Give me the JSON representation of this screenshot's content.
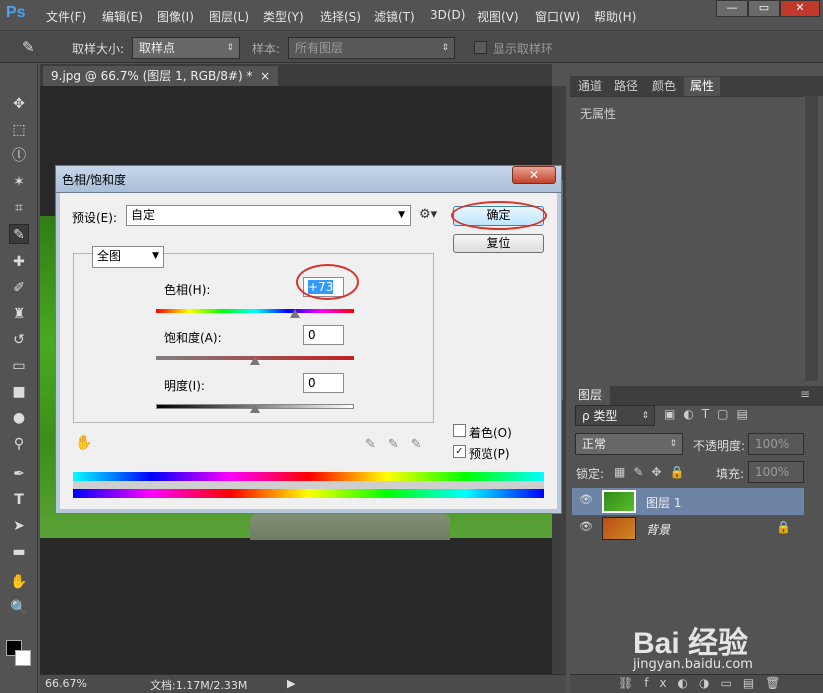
{
  "app": {
    "logo": "Ps"
  },
  "menu": [
    "文件(F)",
    "编辑(E)",
    "图像(I)",
    "图层(L)",
    "类型(Y)",
    "选择(S)",
    "滤镜(T)",
    "3D(D)",
    "视图(V)",
    "窗口(W)",
    "帮助(H)"
  ],
  "window_controls": {
    "minimize": "—",
    "restore": "▭",
    "close": "✕"
  },
  "options": {
    "sample_size_label": "取样大小:",
    "sample_size_value": "取样点",
    "sample_label": "样本:",
    "sample_value": "所有图层",
    "show_ring_label": "显示取样环"
  },
  "document": {
    "tab_title": "9.jpg @ 66.7% (图层 1, RGB/8#) *",
    "tab_close": "×",
    "zoom": "66.67%",
    "doc_info": "文档:1.17M/2.33M"
  },
  "panels": {
    "tabs": [
      "通道",
      "路径",
      "颜色",
      "属性"
    ],
    "active_tab": "属性",
    "properties_text": "无属性",
    "layers_tab": "图层",
    "filter_kind": "ρ 类型",
    "blend_mode": "正常",
    "opacity_label": "不透明度:",
    "opacity_value": "100%",
    "lock_label": "锁定:",
    "fill_label": "填充:",
    "fill_value": "100%",
    "layers": [
      {
        "name": "图层 1",
        "selected": true
      },
      {
        "name": "背景",
        "selected": false
      }
    ]
  },
  "dialog": {
    "title": "色相/饱和度",
    "close": "✕",
    "preset_label": "预设(E):",
    "preset_value": "自定",
    "ok_label": "确定",
    "reset_label": "复位",
    "channel_value": "全图",
    "hue_label": "色相(H):",
    "hue_value": "+73",
    "saturation_label": "饱和度(A):",
    "saturation_value": "0",
    "lightness_label": "明度(I):",
    "lightness_value": "0",
    "colorize_label": "着色(O)",
    "colorize_checked": false,
    "preview_label": "预览(P)",
    "preview_checked": true,
    "hue_position": 0.7,
    "saturation_position": 0.5,
    "lightness_position": 0.5
  },
  "watermark": {
    "brand": "Bai 经验",
    "url": "jingyan.baidu.com"
  }
}
